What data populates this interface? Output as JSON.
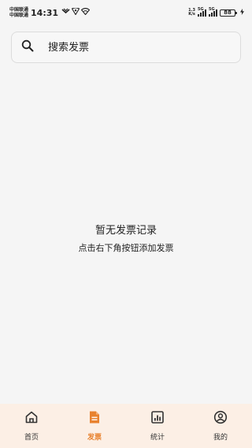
{
  "status_bar": {
    "carrier_1": "中国联通",
    "carrier_2": "中国联通",
    "time": "14:31",
    "speed_value": "1.3",
    "speed_unit": "K/s",
    "signal_1_label": "5G",
    "signal_2_label": "5G",
    "battery": "88"
  },
  "search": {
    "placeholder": "搜索发票",
    "value": ""
  },
  "empty_state": {
    "title": "暂无发票记录",
    "hint": "点击右下角按钮添加发票"
  },
  "nav": {
    "accent_color": "#e8822f",
    "items": [
      {
        "label": "首页",
        "icon": "home-icon",
        "active": false
      },
      {
        "label": "发票",
        "icon": "invoice-icon",
        "active": true
      },
      {
        "label": "统计",
        "icon": "stats-icon",
        "active": false
      },
      {
        "label": "我的",
        "icon": "profile-icon",
        "active": false
      }
    ]
  }
}
